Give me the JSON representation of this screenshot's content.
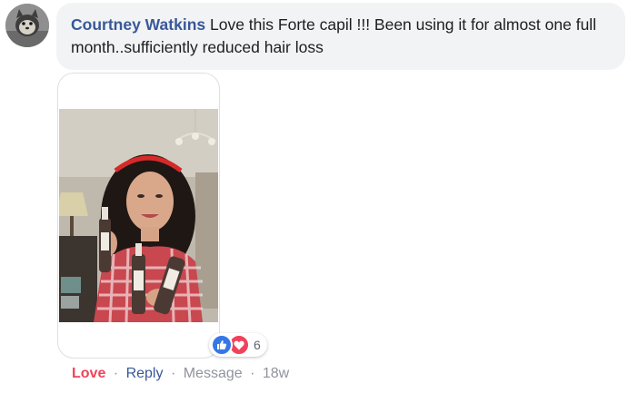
{
  "comment": {
    "author": "Courtney Watkins",
    "text": "Love this Forte capil !!! Been using it for almost one full month..sufficiently reduced hair loss"
  },
  "reactions": {
    "icons": [
      "like-icon",
      "love-icon"
    ],
    "count": "6"
  },
  "actions": {
    "love": "Love",
    "reply": "Reply",
    "message": "Message",
    "time": "18w",
    "separator": "·"
  },
  "colors": {
    "author": "#385898",
    "love": "#f0435a",
    "like": "#3578e5",
    "bubble": "#f2f3f5"
  }
}
